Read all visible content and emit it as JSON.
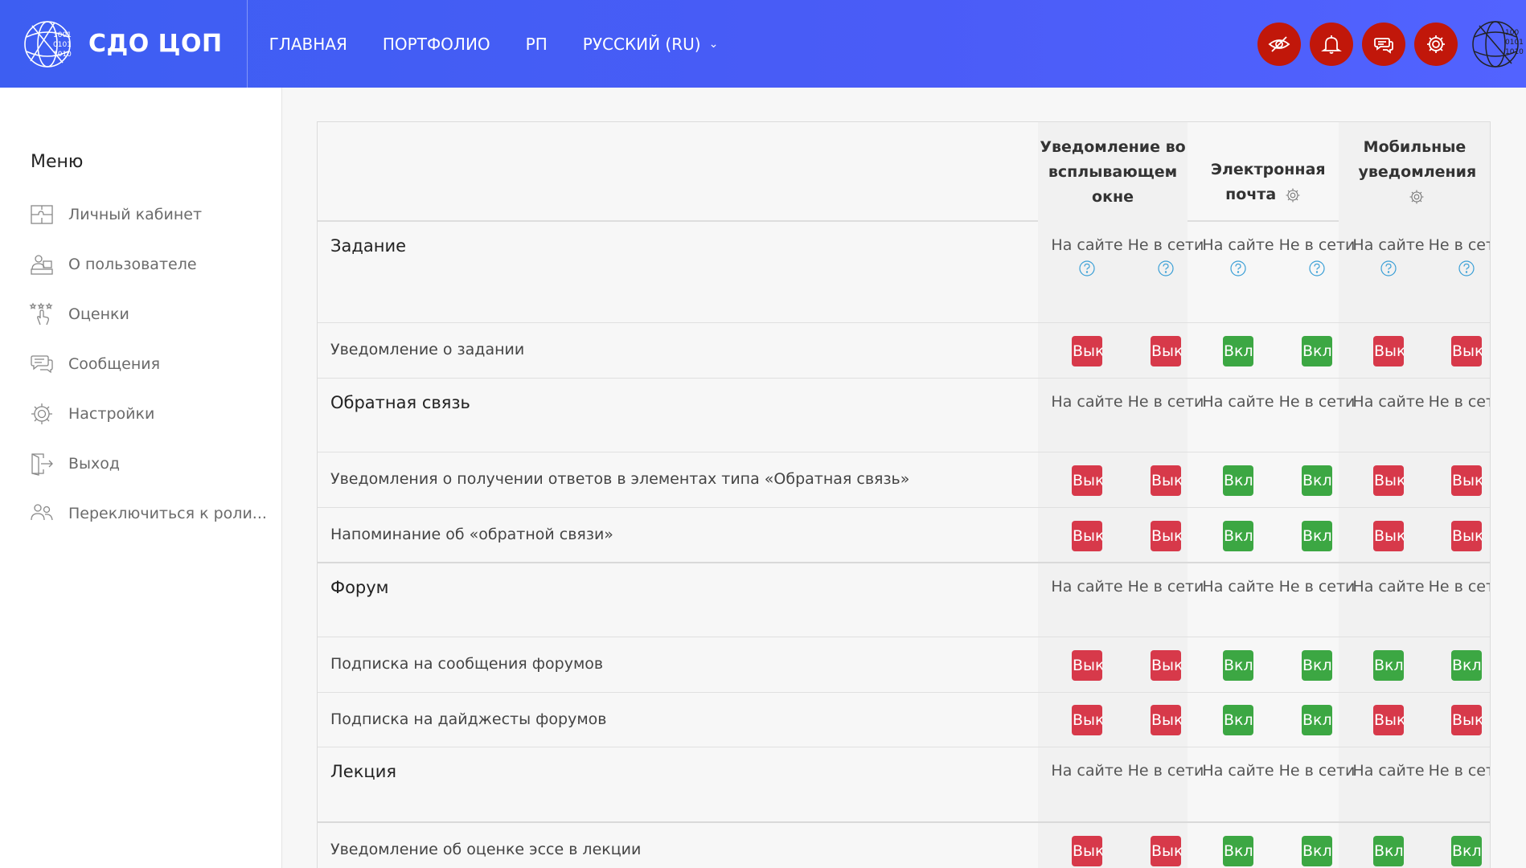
{
  "header": {
    "brand": "СДО ЦОП",
    "nav": [
      "ГЛАВНАЯ",
      "ПОРТФОЛИО",
      "РП",
      "РУССКИЙ (RU)"
    ]
  },
  "sidebar": {
    "title": "Меню",
    "items": [
      "Личный кабинет",
      "О пользователе",
      "Оценки",
      "Сообщения",
      "Настройки",
      "Выход",
      "Переключиться к роли..."
    ]
  },
  "table": {
    "columns": [
      "Уведомление во всплывающем окне",
      "Электронная почта",
      "Мобильные уведомления"
    ],
    "sub": {
      "online": "На сайте",
      "offline": "Не в сети"
    },
    "toggle": {
      "on": "Вкл.",
      "off": "Выкл."
    },
    "sections": [
      {
        "title": "Задание",
        "items": [
          {
            "title": "Уведомление о задании",
            "states": [
              "off",
              "off",
              "on",
              "on",
              "off",
              "off"
            ]
          }
        ]
      },
      {
        "title": "Обратная связь",
        "items": [
          {
            "title": "Уведомления о получении ответов в элементах типа «Обратная связь»",
            "states": [
              "off",
              "off",
              "on",
              "on",
              "off",
              "off"
            ]
          },
          {
            "title": "Напоминание об «обратной связи»",
            "states": [
              "off",
              "off",
              "on",
              "on",
              "off",
              "off"
            ]
          }
        ]
      },
      {
        "title": "Форум",
        "items": [
          {
            "title": "Подписка на сообщения форумов",
            "states": [
              "off",
              "off",
              "on",
              "on",
              "on",
              "on"
            ]
          },
          {
            "title": "Подписка на дайджесты форумов",
            "states": [
              "off",
              "off",
              "on",
              "on",
              "off",
              "off"
            ]
          }
        ]
      },
      {
        "title": "Лекция",
        "items": [
          {
            "title": "Уведомление об оценке эссе в лекции",
            "states": [
              "off",
              "off",
              "on",
              "on",
              "on",
              "on"
            ]
          }
        ]
      }
    ]
  },
  "colors": {
    "header": "#4a5cf7",
    "action": "#c1170a",
    "on": "#3ca743",
    "off": "#d7394a"
  }
}
